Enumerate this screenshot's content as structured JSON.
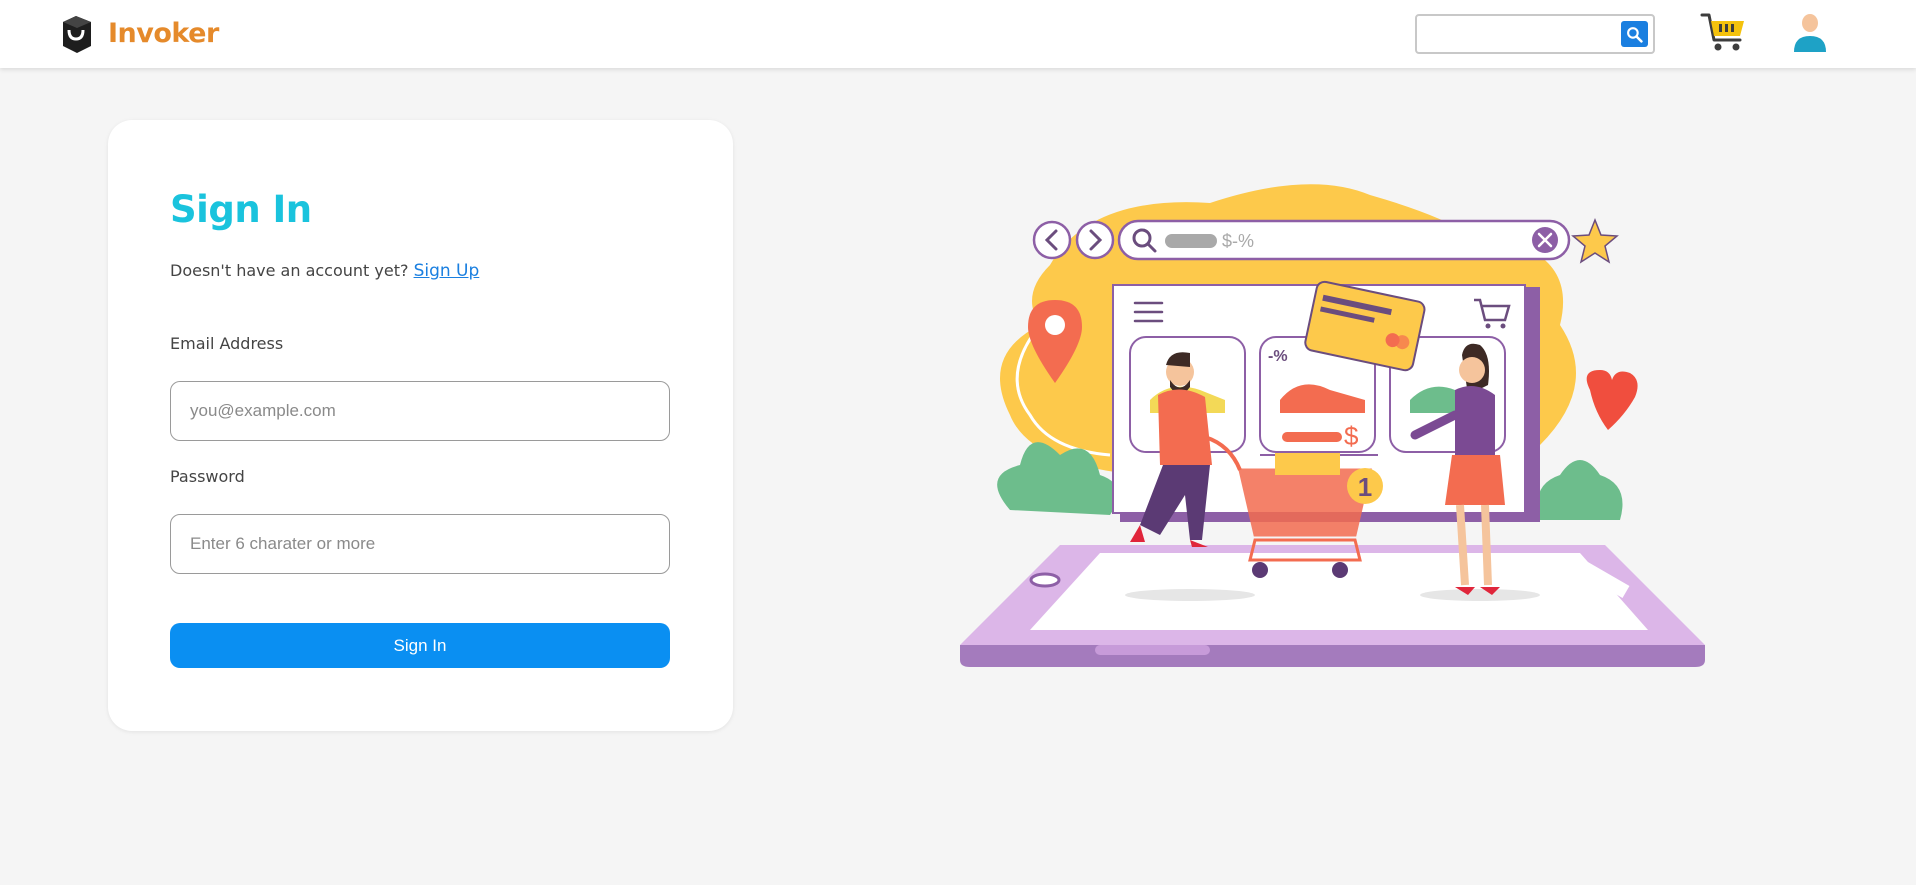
{
  "header": {
    "brand_name": "Invoker",
    "search": {
      "placeholder": "",
      "value": ""
    }
  },
  "login": {
    "title": "Sign In",
    "signup_prompt": "Doesn't have an account yet?",
    "signup_link": "Sign Up",
    "email_label": "Email Address",
    "email_placeholder": "you@example.com",
    "password_label": "Password",
    "password_placeholder": "Enter 6 charater or more",
    "submit_label": "Sign In"
  },
  "illustration": {
    "search_text": "$-%",
    "discount_label": "-%",
    "price_symbol": "$",
    "cart_count": "1"
  },
  "colors": {
    "brand": "#e58a2b",
    "title": "#1ac3dd",
    "primary": "#0a8ff2",
    "link": "#1a7fe0",
    "page_bg": "#f5f5f5"
  },
  "icons": [
    "brand-logo-icon",
    "search-icon",
    "cart-icon",
    "user-icon"
  ]
}
